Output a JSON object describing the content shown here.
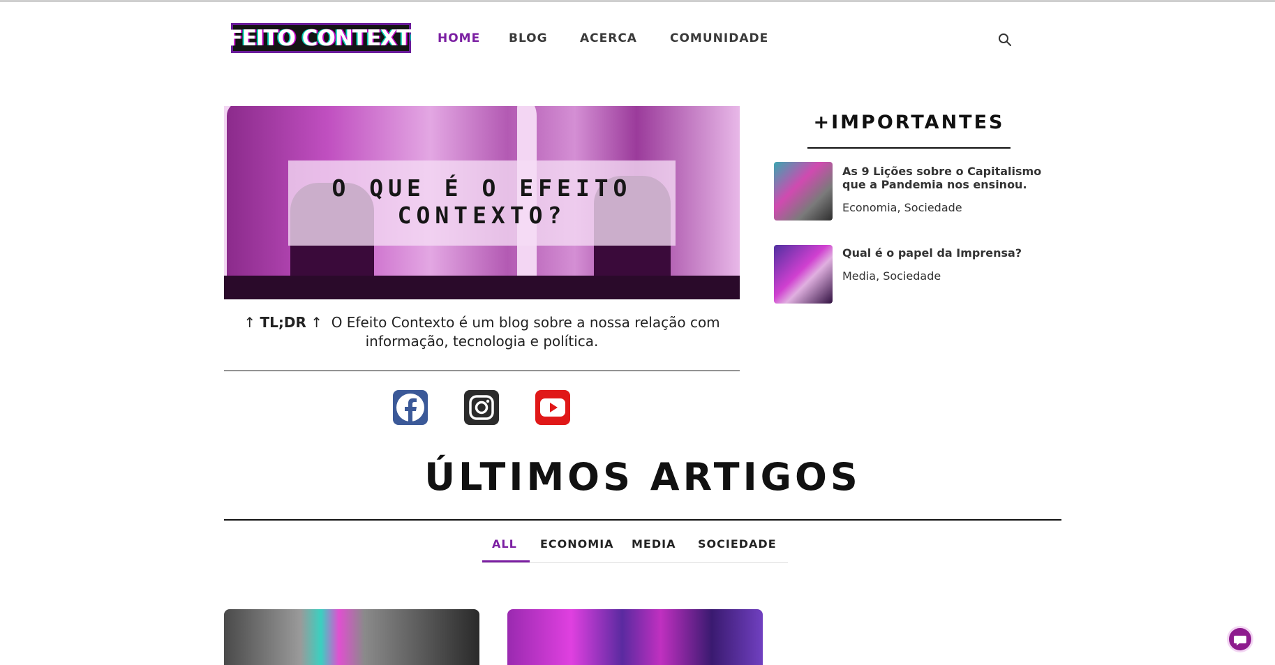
{
  "header": {
    "logo_text": "EFEITO CONTEXTO",
    "nav": [
      "HOME",
      "BLOG",
      "ACERCA",
      "COMUNIDADE"
    ],
    "active_nav": "HOME",
    "search_icon": "search-icon"
  },
  "hero": {
    "title": "O QUE É O EFEITO CONTEXTO?",
    "tldr_arrow_left": "↑ ",
    "tldr_label": "TL;DR",
    "tldr_arrow_right": " ↑",
    "tldr_text": "O Efeito Contexto é um blog sobre a nossa relação com informação, tecnologia e política."
  },
  "social": [
    {
      "name": "facebook-icon",
      "color": "#3b5998"
    },
    {
      "name": "instagram-icon",
      "color": "#2b2b2b"
    },
    {
      "name": "youtube-icon",
      "color": "#e01818"
    }
  ],
  "sidebar": {
    "title": "+IMPORTANTES",
    "articles": [
      {
        "title": "As 9 Lições sobre o Capitalismo que a Pandemia nos ensinou.",
        "cats": [
          "Economia",
          "Sociedade"
        ]
      },
      {
        "title": "Qual é o papel da Imprensa?",
        "cats": [
          "Media",
          "Sociedade"
        ]
      }
    ]
  },
  "latest": {
    "title": "ÚLTIMOS ARTIGOS",
    "tabs": [
      "ALL",
      "ECONOMIA",
      "MEDIA",
      "SOCIEDADE"
    ],
    "active_tab": "ALL"
  },
  "colors": {
    "accent": "#7b1fa2",
    "text": "#111111"
  }
}
